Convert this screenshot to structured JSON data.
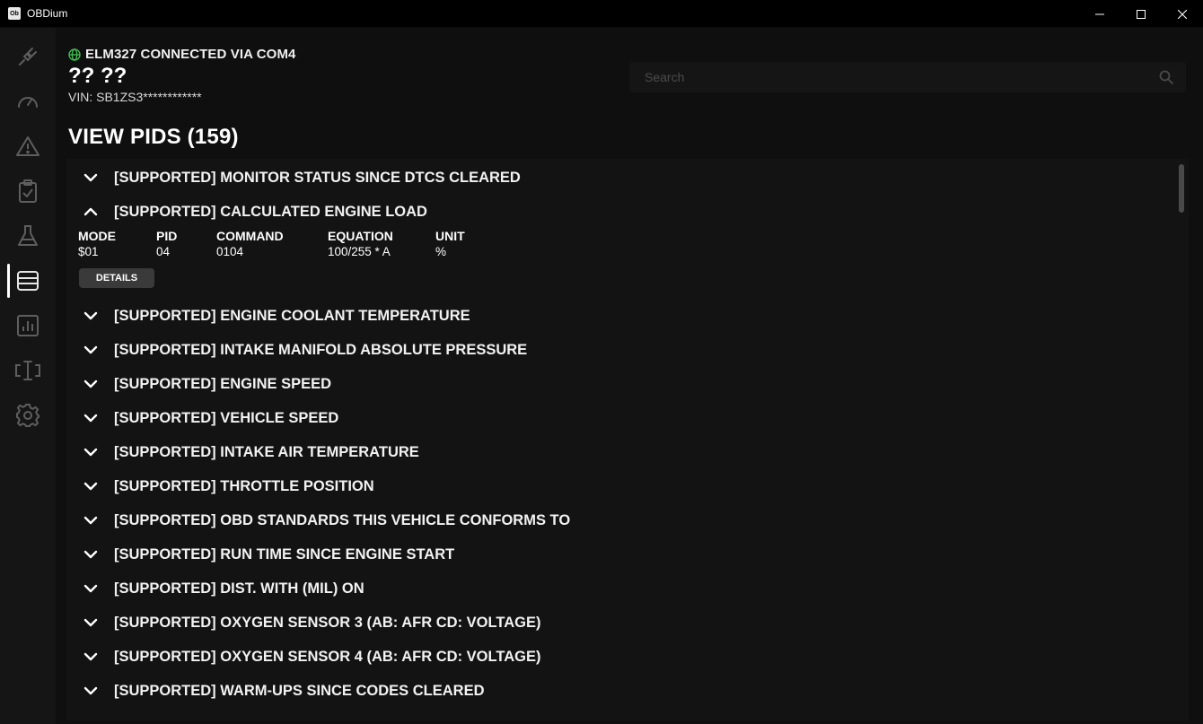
{
  "window": {
    "title": "OBDium",
    "app_icon_text": "Ob",
    "minimize_icon": "minimize-icon",
    "maximize_icon": "maximize-icon",
    "close_icon": "close-icon"
  },
  "sidebar": {
    "items": [
      {
        "name": "connection",
        "icon": "plug-icon"
      },
      {
        "name": "dashboard",
        "icon": "gauge-icon"
      },
      {
        "name": "diagnostics",
        "icon": "warning-icon"
      },
      {
        "name": "readiness",
        "icon": "clipboard-check-icon"
      },
      {
        "name": "tests",
        "icon": "flask-icon"
      },
      {
        "name": "pids",
        "icon": "list-icon",
        "active": true
      },
      {
        "name": "graphs",
        "icon": "bar-chart-icon"
      },
      {
        "name": "terminal",
        "icon": "text-cursor-icon"
      },
      {
        "name": "settings",
        "icon": "gear-icon"
      }
    ]
  },
  "header": {
    "connection_status": "ELM327 CONNECTED VIA COM4",
    "status_color": "#3fb950",
    "vehicle_name": "?? ??",
    "vin": "VIN: SB1ZS3************"
  },
  "search": {
    "placeholder": "Search",
    "value": ""
  },
  "view_title": "VIEW PIDS (159)",
  "pids": [
    {
      "label": "[SUPPORTED] MONITOR STATUS SINCE DTCS CLEARED",
      "expanded": false
    },
    {
      "label": "[SUPPORTED] CALCULATED ENGINE LOAD",
      "expanded": true
    },
    {
      "label": "[SUPPORTED] ENGINE COOLANT TEMPERATURE",
      "expanded": false
    },
    {
      "label": "[SUPPORTED] INTAKE MANIFOLD ABSOLUTE PRESSURE",
      "expanded": false
    },
    {
      "label": "[SUPPORTED] ENGINE SPEED",
      "expanded": false
    },
    {
      "label": "[SUPPORTED] VEHICLE SPEED",
      "expanded": false
    },
    {
      "label": "[SUPPORTED] INTAKE AIR TEMPERATURE",
      "expanded": false
    },
    {
      "label": "[SUPPORTED] THROTTLE POSITION",
      "expanded": false
    },
    {
      "label": "[SUPPORTED] OBD STANDARDS THIS VEHICLE CONFORMS TO",
      "expanded": false
    },
    {
      "label": "[SUPPORTED] RUN TIME SINCE ENGINE START",
      "expanded": false
    },
    {
      "label": "[SUPPORTED] DIST. WITH (MIL) ON",
      "expanded": false
    },
    {
      "label": "[SUPPORTED] OXYGEN SENSOR 3 (AB: AFR CD: VOLTAGE)",
      "expanded": false
    },
    {
      "label": "[SUPPORTED] OXYGEN SENSOR 4 (AB: AFR CD: VOLTAGE)",
      "expanded": false
    },
    {
      "label": "[SUPPORTED] WARM-UPS SINCE CODES CLEARED",
      "expanded": false
    }
  ],
  "expanded_details": {
    "mode_label": "MODE",
    "mode_value": "$01",
    "pid_label": "PID",
    "pid_value": "04",
    "command_label": "COMMAND",
    "command_value": "0104",
    "equation_label": "EQUATION",
    "equation_value": "100/255 * A",
    "unit_label": "UNIT",
    "unit_value": "%",
    "details_button": "DETAILS"
  }
}
